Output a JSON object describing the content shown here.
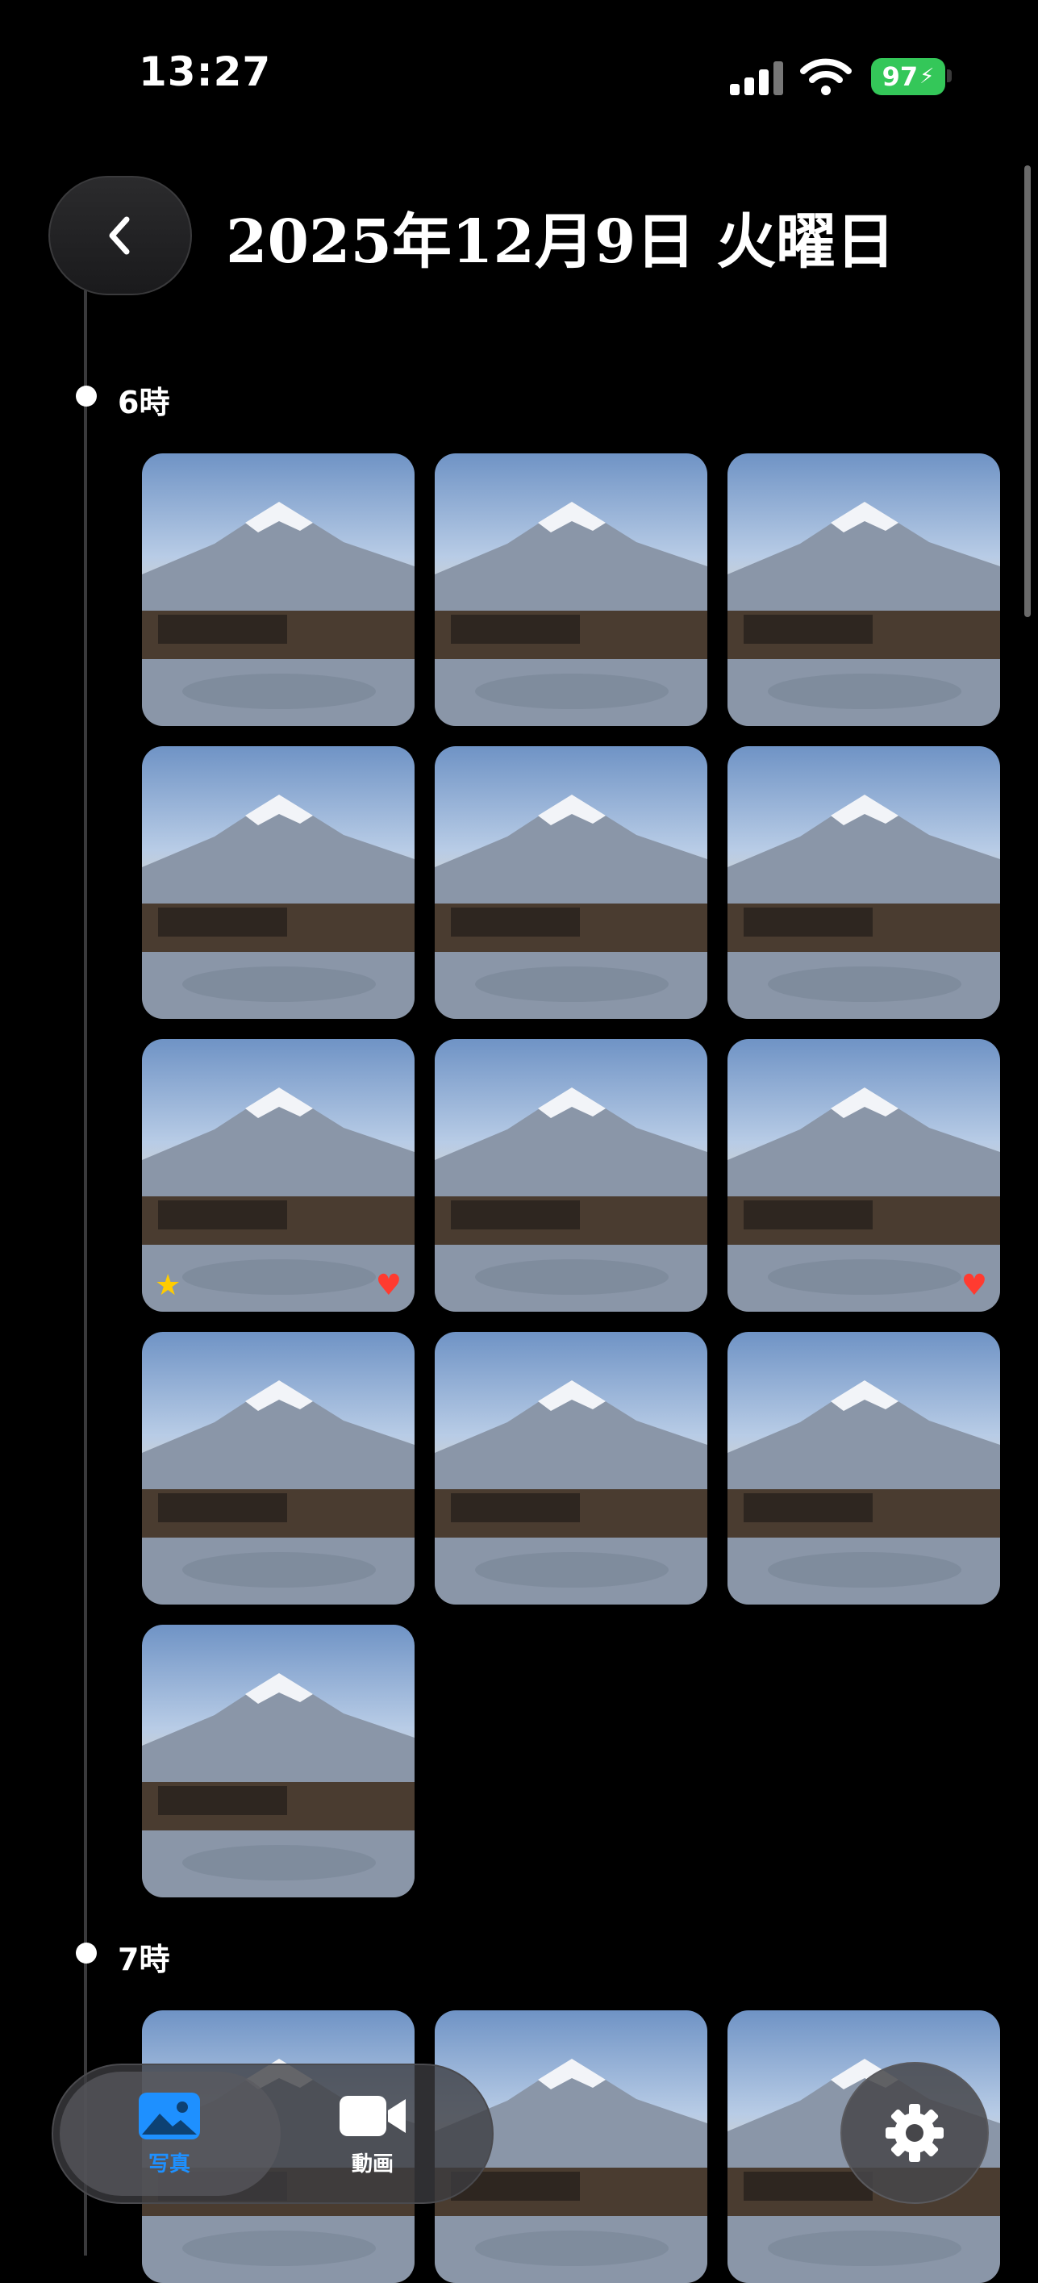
{
  "status_bar": {
    "time": "13:27",
    "battery": "97"
  },
  "header": {
    "title": "2025年12月9日 火曜日"
  },
  "sections": [
    {
      "hour": "6時"
    },
    {
      "hour": "7時"
    }
  ],
  "tabs": {
    "photos": "写真",
    "videos": "動画"
  },
  "colors": {
    "accent": "#1e90ff",
    "battery": "#34c759",
    "favorite": "#ff3b30",
    "star": "#ffcc00"
  },
  "icons": {
    "back": "chevron-left-icon",
    "photos": "photo-icon",
    "videos": "video-camera-icon",
    "settings": "gear-icon"
  }
}
